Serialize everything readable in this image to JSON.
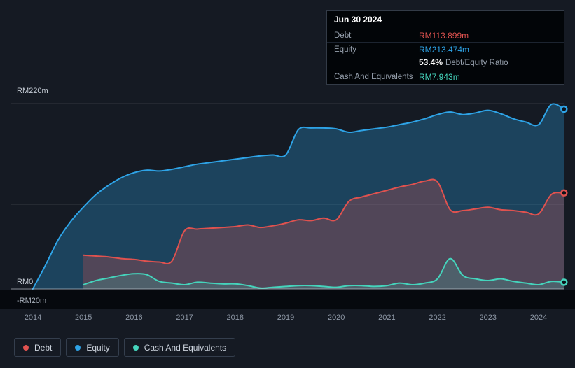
{
  "colors": {
    "debt": "#e0524f",
    "equity": "#2ea3e6",
    "cash": "#45d4bc",
    "background": "#151a23",
    "negative_band": "#06090e"
  },
  "tooltip": {
    "date": "Jun 30 2024",
    "debt_label": "Debt",
    "debt_value": "RM113.899m",
    "equity_label": "Equity",
    "equity_value": "RM213.474m",
    "ratio_value": "53.4%",
    "ratio_label": "Debt/Equity Ratio",
    "cash_label": "Cash And Equivalents",
    "cash_value": "RM7.943m"
  },
  "y_axis": {
    "top": "RM220m",
    "zero": "RM0",
    "negative": "-RM20m"
  },
  "x_axis": {
    "ticks": [
      "2014",
      "2015",
      "2016",
      "2017",
      "2018",
      "2019",
      "2020",
      "2021",
      "2022",
      "2023",
      "2024"
    ]
  },
  "legend": [
    {
      "label": "Debt",
      "key": "debt"
    },
    {
      "label": "Equity",
      "key": "equity"
    },
    {
      "label": "Cash And Equivalents",
      "key": "cash"
    }
  ],
  "chart_data": {
    "type": "area",
    "title": "Debt to Equity History",
    "xlim": [
      2013.56,
      2024.51
    ],
    "ylim": [
      -20,
      230
    ],
    "y_reference_labels": {
      "220": "RM220m",
      "0": "RM0",
      "-20": "-RM20m"
    },
    "x": [
      2014,
      2014.25,
      2014.5,
      2014.75,
      2015,
      2015.25,
      2015.5,
      2015.75,
      2016,
      2016.25,
      2016.5,
      2016.75,
      2017,
      2017.25,
      2017.5,
      2017.75,
      2018,
      2018.25,
      2018.5,
      2018.75,
      2019,
      2019.25,
      2019.5,
      2019.75,
      2020,
      2020.25,
      2020.5,
      2020.75,
      2021,
      2021.25,
      2021.5,
      2021.75,
      2022,
      2022.25,
      2022.5,
      2022.75,
      2023,
      2023.25,
      2023.5,
      2023.75,
      2024,
      2024.25,
      2024.5
    ],
    "series": [
      {
        "name": "Equity",
        "key": "equity",
        "unit": "RM millions",
        "values": [
          0,
          28,
          58,
          80,
          97,
          112,
          123,
          132,
          138,
          141,
          140,
          142,
          145,
          148,
          150,
          152,
          154,
          156,
          158,
          159,
          159,
          189,
          191,
          191,
          190,
          186,
          188,
          190,
          192,
          195,
          198,
          202,
          207,
          210,
          207,
          209,
          212,
          208,
          202,
          198,
          195,
          219,
          213.474
        ]
      },
      {
        "name": "Debt",
        "key": "debt",
        "unit": "RM millions",
        "values": [
          null,
          null,
          null,
          null,
          40,
          39,
          38,
          36,
          35,
          33,
          32,
          33,
          69,
          71,
          72,
          73,
          74,
          76,
          73,
          75,
          78,
          82,
          81,
          84,
          82,
          104,
          109,
          113,
          117,
          121,
          124,
          128,
          127,
          94,
          93,
          95,
          97,
          94,
          93,
          91,
          89,
          112,
          113.899
        ]
      },
      {
        "name": "Cash And Equivalents",
        "key": "cash",
        "unit": "RM millions",
        "values": [
          null,
          null,
          null,
          null,
          5,
          10,
          13,
          16,
          18,
          17,
          9,
          7,
          5,
          8,
          7,
          6,
          6,
          4,
          1,
          2,
          3,
          4,
          4,
          3,
          2,
          4,
          4,
          3,
          4,
          7,
          5,
          7,
          12,
          36,
          16,
          12,
          10,
          12,
          9,
          7,
          5,
          9,
          7.943
        ]
      }
    ],
    "gridlines": [
      220,
      100,
      0
    ],
    "legend_position": "bottom-left",
    "last_point_markers": true
  }
}
